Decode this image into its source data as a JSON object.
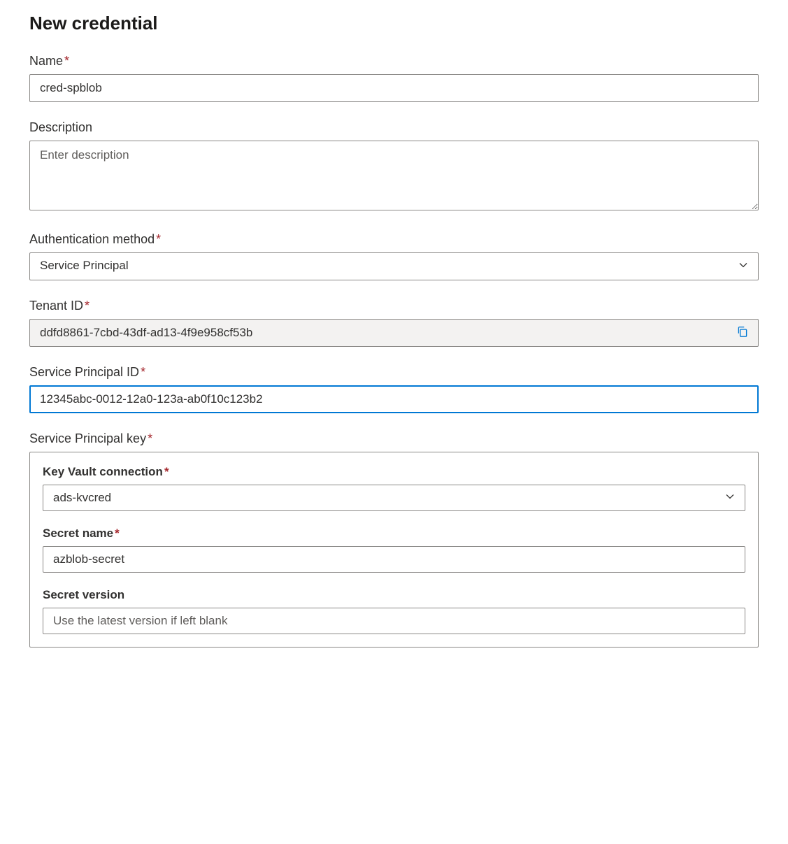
{
  "page_title": "New credential",
  "fields": {
    "name": {
      "label": "Name",
      "value": "cred-spblob",
      "required": true
    },
    "description": {
      "label": "Description",
      "placeholder": "Enter description",
      "value": ""
    },
    "auth_method": {
      "label": "Authentication method",
      "value": "Service Principal",
      "required": true
    },
    "tenant_id": {
      "label": "Tenant ID",
      "value": "ddfd8861-7cbd-43df-ad13-4f9e958cf53b",
      "required": true
    },
    "sp_id": {
      "label": "Service Principal ID",
      "value": "12345abc-0012-12a0-123a-ab0f10c123b2",
      "required": true
    },
    "sp_key": {
      "label": "Service Principal key",
      "required": true,
      "kv_connection": {
        "label": "Key Vault connection",
        "value": "ads-kvcred",
        "required": true
      },
      "secret_name": {
        "label": "Secret name",
        "value": "azblob-secret",
        "required": true
      },
      "secret_version": {
        "label": "Secret version",
        "placeholder": "Use the latest version if left blank",
        "value": ""
      }
    }
  }
}
